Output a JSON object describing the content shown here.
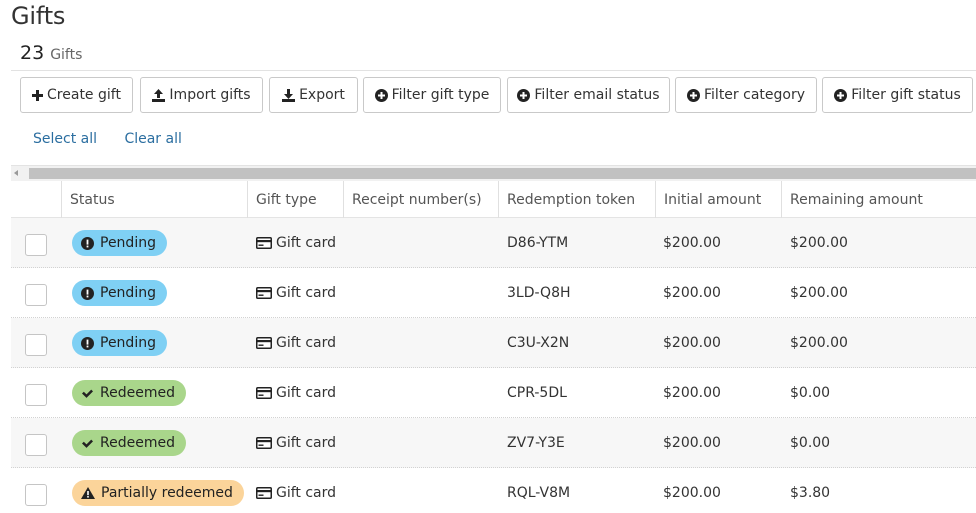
{
  "page": {
    "title": "Gifts"
  },
  "summary": {
    "count": "23",
    "count_label": "Gifts"
  },
  "toolbar": {
    "buttons": [
      {
        "label": "Create gift",
        "icon": "plus-icon"
      },
      {
        "label": "Import gifts",
        "icon": "upload-icon"
      },
      {
        "label": "Export",
        "icon": "download-icon"
      },
      {
        "label": "Filter gift type",
        "icon": "plus-circle-icon"
      },
      {
        "label": "Filter email status",
        "icon": "plus-circle-icon"
      },
      {
        "label": "Filter category",
        "icon": "plus-circle-icon"
      },
      {
        "label": "Filter gift status",
        "icon": "plus-circle-icon"
      }
    ]
  },
  "selection": {
    "select_all": "Select all",
    "clear_all": "Clear all"
  },
  "table": {
    "columns": [
      "Status",
      "Gift type",
      "Receipt number(s)",
      "Redemption token",
      "Initial amount",
      "Remaining amount"
    ],
    "rows": [
      {
        "status": "Pending",
        "status_kind": "pending",
        "gift_type": "Gift card",
        "receipt": "",
        "token": "D86-YTM",
        "initial": "$200.00",
        "remaining": "$200.00"
      },
      {
        "status": "Pending",
        "status_kind": "pending",
        "gift_type": "Gift card",
        "receipt": "",
        "token": "3LD-Q8H",
        "initial": "$200.00",
        "remaining": "$200.00"
      },
      {
        "status": "Pending",
        "status_kind": "pending",
        "gift_type": "Gift card",
        "receipt": "",
        "token": "C3U-X2N",
        "initial": "$200.00",
        "remaining": "$200.00"
      },
      {
        "status": "Redeemed",
        "status_kind": "redeemed",
        "gift_type": "Gift card",
        "receipt": "",
        "token": "CPR-5DL",
        "initial": "$200.00",
        "remaining": "$0.00"
      },
      {
        "status": "Redeemed",
        "status_kind": "redeemed",
        "gift_type": "Gift card",
        "receipt": "",
        "token": "ZV7-Y3E",
        "initial": "$200.00",
        "remaining": "$0.00"
      },
      {
        "status": "Partially redeemed",
        "status_kind": "partial",
        "gift_type": "Gift card",
        "receipt": "",
        "token": "RQL-V8M",
        "initial": "$200.00",
        "remaining": "$3.80"
      }
    ]
  },
  "colors": {
    "pending": "#7fd0f4",
    "redeemed": "#a9d68b",
    "partial": "#fbd49a",
    "link": "#2b6ea0"
  }
}
